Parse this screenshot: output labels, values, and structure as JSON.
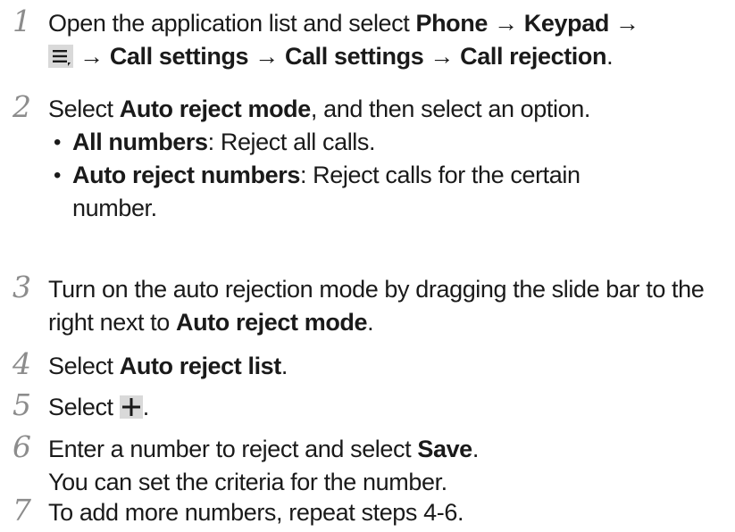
{
  "steps": [
    {
      "number": "1",
      "line1_pre": "Open the application list and select ",
      "line1_phone": "Phone",
      "arrow1": " → ",
      "line1_keypad": "Keypad",
      "arrow2": " →",
      "menu_icon": "menu-key-icon",
      "arrow3": " → ",
      "line2_callsettings1": "Call settings",
      "arrow4": " → ",
      "line2_callsettings2": "Call settings",
      "arrow5": " → ",
      "line2_callrejection": "Call rejection",
      "line2_end": "."
    },
    {
      "number": "2",
      "pre": "Select ",
      "bold": "Auto reject mode",
      "post": ", and then select an option.",
      "options": [
        {
          "bold": "All numbers",
          "text": ": Reject all calls."
        },
        {
          "bold": "Auto reject numbers",
          "text": ": Reject calls for the certain number."
        }
      ]
    },
    {
      "number": "3",
      "pre": "Turn on the auto rejection mode by dragging the slide bar to the right next to ",
      "bold": "Auto reject mode",
      "post": "."
    },
    {
      "number": "4",
      "pre": "Select ",
      "bold": "Auto reject list",
      "post": "."
    },
    {
      "number": "5",
      "pre": "Select ",
      "plus_icon": "plus-icon",
      "post": "."
    },
    {
      "number": "6",
      "pre": "Enter a number to reject and select ",
      "bold": "Save",
      "post": ".",
      "note": "You can set the criteria for the number."
    },
    {
      "number": "7",
      "text": "To add more numbers, repeat steps 4-6."
    }
  ],
  "colors": {
    "text": "#1a1a1a",
    "step_number": "#8c8c8c",
    "icon_bg": "#d9d9d9"
  }
}
